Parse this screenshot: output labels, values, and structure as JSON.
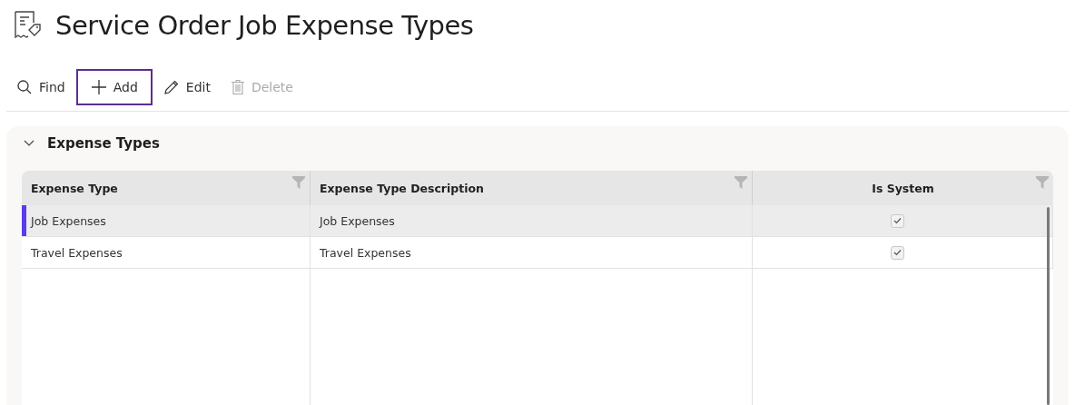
{
  "page": {
    "title": "Service Order Job Expense Types"
  },
  "toolbar": [
    {
      "kind": "find",
      "label": "Find",
      "disabled": false,
      "focused": false
    },
    {
      "kind": "add",
      "label": "Add",
      "disabled": false,
      "focused": true
    },
    {
      "kind": "edit",
      "label": "Edit",
      "disabled": false,
      "focused": false
    },
    {
      "kind": "delete",
      "label": "Delete",
      "disabled": true,
      "focused": false
    }
  ],
  "section": {
    "title": "Expense Types",
    "expanded": true,
    "table": {
      "columns": [
        {
          "label": "Expense Type",
          "kind": "text"
        },
        {
          "label": "Expense Type Description",
          "kind": "text"
        },
        {
          "label": "Is System",
          "kind": "checkbox"
        }
      ],
      "rows": [
        {
          "selected": true,
          "expense_type": "Job Expenses",
          "description": "Job Expenses",
          "is_system": true
        },
        {
          "selected": false,
          "expense_type": "Travel Expenses",
          "description": "Travel Expenses",
          "is_system": true
        }
      ]
    }
  }
}
